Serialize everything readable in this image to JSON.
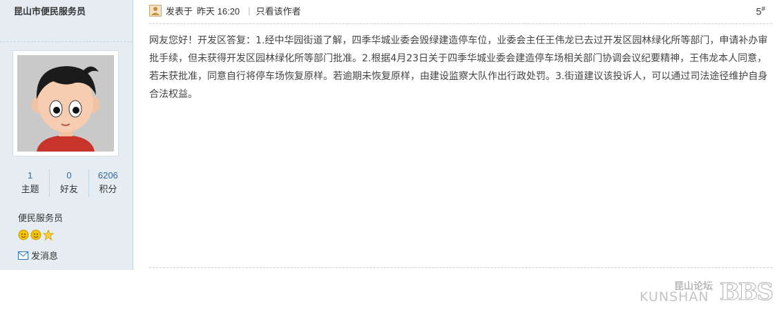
{
  "author": {
    "name": "昆山市便民服务员",
    "stats": [
      {
        "value": "1",
        "label": "主题"
      },
      {
        "value": "0",
        "label": "好友"
      },
      {
        "value": "6206",
        "label": "积分"
      }
    ],
    "group": "便民服务员",
    "rank_icons": [
      "sun-icon",
      "sun-icon",
      "star-icon"
    ],
    "pm_label": "发消息"
  },
  "post": {
    "posted_label": "发表于",
    "posted_time": "昨天 16:20",
    "author_only_label": "只看该作者",
    "floor": "5",
    "floor_mark": "#",
    "body": "网友您好！开发区答复：1.经中华园街道了解，四季华城业委会毁绿建造停车位，业委会主任王伟龙已去过开发区园林绿化所等部门，申请补办审批手续，但未获得开发区园林绿化所等部门批准。2.根据4月23日关于四季华城业委会建造停车场相关部门协调会议纪要精神，王伟龙本人同意，若未获批准，同意自行将停车场恢复原样。若逾期未恢复原样，由建设监察大队作出行政处罚。3.街道建议该投诉人，可以通过司法途径维护自身合法权益。"
  },
  "watermark": {
    "cn": "昆山论坛",
    "en": "KUNSHAN",
    "bbs": "BBS"
  },
  "colors": {
    "sidebar_bg": "#e5edf2",
    "stat_value": "#336699",
    "sun_icon": "#f5c400",
    "star_icon": "#ffd24a"
  }
}
